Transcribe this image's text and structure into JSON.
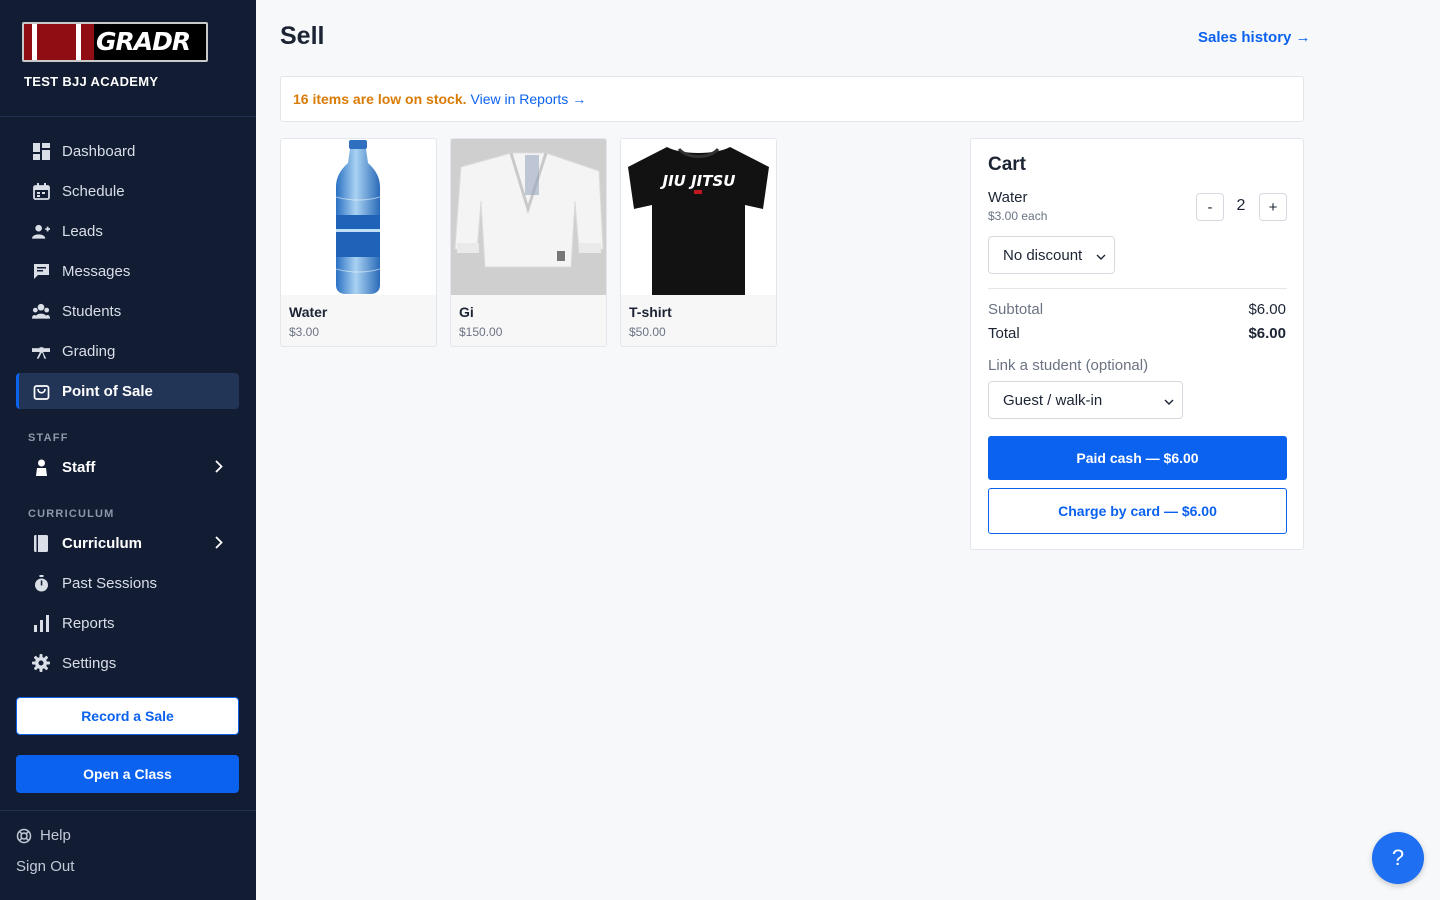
{
  "brand": {
    "logo_text": "GRADR",
    "academy": "TEST BJJ ACADEMY"
  },
  "sidebar": {
    "items": [
      {
        "label": "Dashboard",
        "icon": "dashboard-icon"
      },
      {
        "label": "Schedule",
        "icon": "calendar-icon"
      },
      {
        "label": "Leads",
        "icon": "add-person-icon"
      },
      {
        "label": "Messages",
        "icon": "chat-icon"
      },
      {
        "label": "Students",
        "icon": "group-icon"
      },
      {
        "label": "Grading",
        "icon": "belt-icon"
      },
      {
        "label": "Point of Sale",
        "icon": "shopping-bag-icon",
        "active": true
      }
    ],
    "staff_section": "STAFF",
    "staff_item": "Staff",
    "curriculum_section": "CURRICULUM",
    "curriculum_item": "Curriculum",
    "lower_items": [
      {
        "label": "Past Sessions",
        "icon": "stopwatch-icon"
      },
      {
        "label": "Reports",
        "icon": "bar-chart-icon"
      },
      {
        "label": "Settings",
        "icon": "gear-icon"
      }
    ],
    "record_sale": "Record a Sale",
    "open_class": "Open a Class",
    "help": "Help",
    "sign_out": "Sign Out"
  },
  "main": {
    "title": "Sell",
    "sales_history": "Sales history →",
    "alert_warning": "16 items are low on stock.",
    "alert_link": "View in Reports →"
  },
  "products": [
    {
      "name": "Water",
      "price": "$3.00"
    },
    {
      "name": "Gi",
      "price": "$150.00"
    },
    {
      "name": "T-shirt",
      "price": "$50.00",
      "print": "JIU JITSU"
    }
  ],
  "cart": {
    "title": "Cart",
    "item_name": "Water",
    "item_each": "$3.00 each",
    "qty_minus": "-",
    "qty": "2",
    "qty_plus": "+",
    "discount": "No discount",
    "subtotal_label": "Subtotal",
    "subtotal": "$6.00",
    "total_label": "Total",
    "total": "$6.00",
    "link_label": "Link a student (optional)",
    "student": "Guest / walk-in",
    "pay_cash": "Paid cash — $6.00",
    "pay_card": "Charge by card — $6.00"
  },
  "help_fab": "?",
  "colors": {
    "sidebar_bg": "#121d33",
    "accent": "#0b62ef",
    "warning": "#d97b07"
  }
}
